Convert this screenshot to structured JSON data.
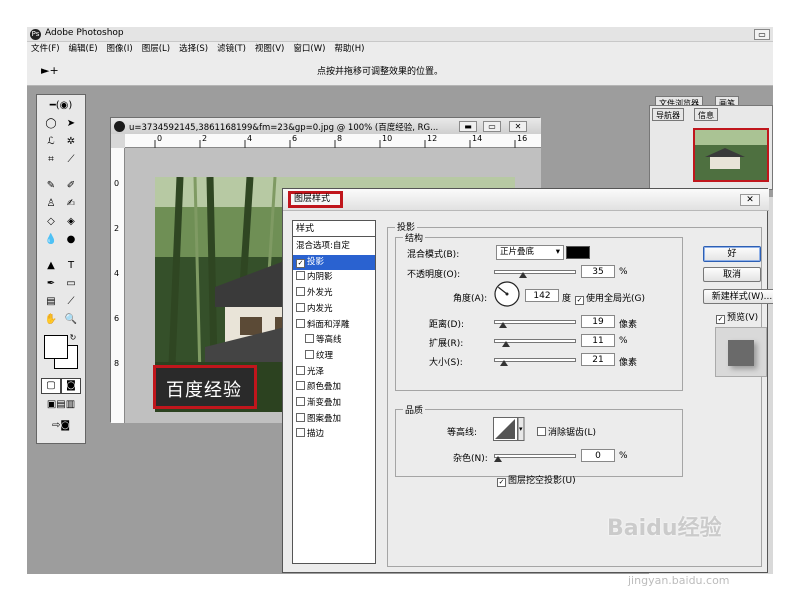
{
  "app": {
    "title": "Adobe Photoshop",
    "icon_glyph": "Ps",
    "minimize_glyph": "▭"
  },
  "menubar": [
    "文件(F)",
    "编辑(E)",
    "图像(I)",
    "图层(L)",
    "选择(S)",
    "滤镜(T)",
    "视图(V)",
    "窗口(W)",
    "帮助(H)"
  ],
  "options_bar": {
    "tool_glyph": "►+",
    "hint": "点按并拖移可调整效果的位置。",
    "well_tabs": [
      "文件浏览器",
      "画笔"
    ]
  },
  "document": {
    "title": "u=3734592145,3861168199&fm=23&gp=0.jpg @ 100% (百度经验, RG...",
    "ruler_top": [
      "0",
      "2",
      "4",
      "6",
      "8",
      "10",
      "12",
      "14",
      "16"
    ],
    "ruler_left": [
      "0",
      "2",
      "4",
      "6",
      "8"
    ],
    "watermark": "百度经验"
  },
  "navigator": {
    "tabs": [
      "导航器",
      "信息"
    ]
  },
  "dialog": {
    "title": "图层样式",
    "close_glyph": "✕",
    "styles_header": "样式",
    "styles": [
      {
        "label": "混合选项:自定",
        "checkbox": false,
        "checked": false,
        "selected": false,
        "indent": false
      },
      {
        "label": "投影",
        "checkbox": true,
        "checked": true,
        "selected": true,
        "indent": false
      },
      {
        "label": "内阴影",
        "checkbox": true,
        "checked": false,
        "selected": false,
        "indent": false
      },
      {
        "label": "外发光",
        "checkbox": true,
        "checked": false,
        "selected": false,
        "indent": false
      },
      {
        "label": "内发光",
        "checkbox": true,
        "checked": false,
        "selected": false,
        "indent": false
      },
      {
        "label": "斜面和浮雕",
        "checkbox": true,
        "checked": false,
        "selected": false,
        "indent": false
      },
      {
        "label": "等高线",
        "checkbox": true,
        "checked": false,
        "selected": false,
        "indent": true
      },
      {
        "label": "纹理",
        "checkbox": true,
        "checked": false,
        "selected": false,
        "indent": true
      },
      {
        "label": "光泽",
        "checkbox": true,
        "checked": false,
        "selected": false,
        "indent": false
      },
      {
        "label": "颜色叠加",
        "checkbox": true,
        "checked": false,
        "selected": false,
        "indent": false
      },
      {
        "label": "渐变叠加",
        "checkbox": true,
        "checked": false,
        "selected": false,
        "indent": false
      },
      {
        "label": "图案叠加",
        "checkbox": true,
        "checked": false,
        "selected": false,
        "indent": false
      },
      {
        "label": "描边",
        "checkbox": true,
        "checked": false,
        "selected": false,
        "indent": false
      }
    ],
    "drop_shadow": {
      "section": "投影",
      "structure": "结构",
      "blend_mode_label": "混合模式(B):",
      "blend_mode_value": "正片叠底",
      "shadow_color": "#000000",
      "opacity_label": "不透明度(O):",
      "opacity_value": "35",
      "opacity_unit": "%",
      "angle_label": "角度(A):",
      "angle_value": "142",
      "angle_unit": "度",
      "global_light_label": "使用全局光(G)",
      "global_light_checked": true,
      "distance_label": "距离(D):",
      "distance_value": "19",
      "distance_unit": "像素",
      "spread_label": "扩展(R):",
      "spread_value": "11",
      "spread_unit": "%",
      "size_label": "大小(S):",
      "size_value": "21",
      "size_unit": "像素",
      "quality": "品质",
      "contour_label": "等高线:",
      "anti_alias_label": "消除锯齿(L)",
      "anti_alias_checked": false,
      "noise_label": "杂色(N):",
      "noise_value": "0",
      "noise_unit": "%",
      "knockout_label": "图层挖空投影(U)",
      "knockout_checked": true
    },
    "buttons": {
      "ok": "好",
      "cancel": "取消",
      "new_style": "新建样式(W)...",
      "preview_label": "预览(V)",
      "preview_checked": true
    }
  },
  "site_watermark": {
    "main": "Baidu经验",
    "sub": "jingyan.baidu.com"
  }
}
